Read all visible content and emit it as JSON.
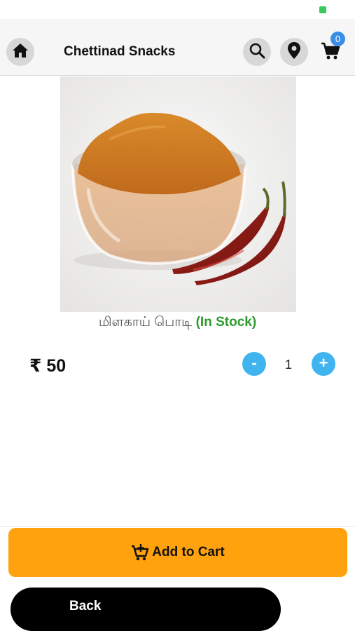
{
  "header": {
    "title": "Chettinad Snacks",
    "cart_count": "0",
    "icons": [
      "home-icon",
      "search-icon",
      "location-pin-icon",
      "cart-icon"
    ]
  },
  "product": {
    "name": "மிளகாய் பொடி",
    "stock_status": "(In Stock)",
    "price": "₹ 50",
    "quantity": "1",
    "image_description": "chili-powder-bowl-with-dried-red-chilies"
  },
  "controls": {
    "minus_label": "-",
    "plus_label": "+"
  },
  "actions": {
    "add_to_cart_label": "Add to Cart",
    "back_label": "Back"
  },
  "colors": {
    "accent_orange": "#ffa20d",
    "stock_green": "#2e9a2e",
    "qty_blue": "#3fb4ef",
    "badge_blue": "#3a8ee6"
  }
}
